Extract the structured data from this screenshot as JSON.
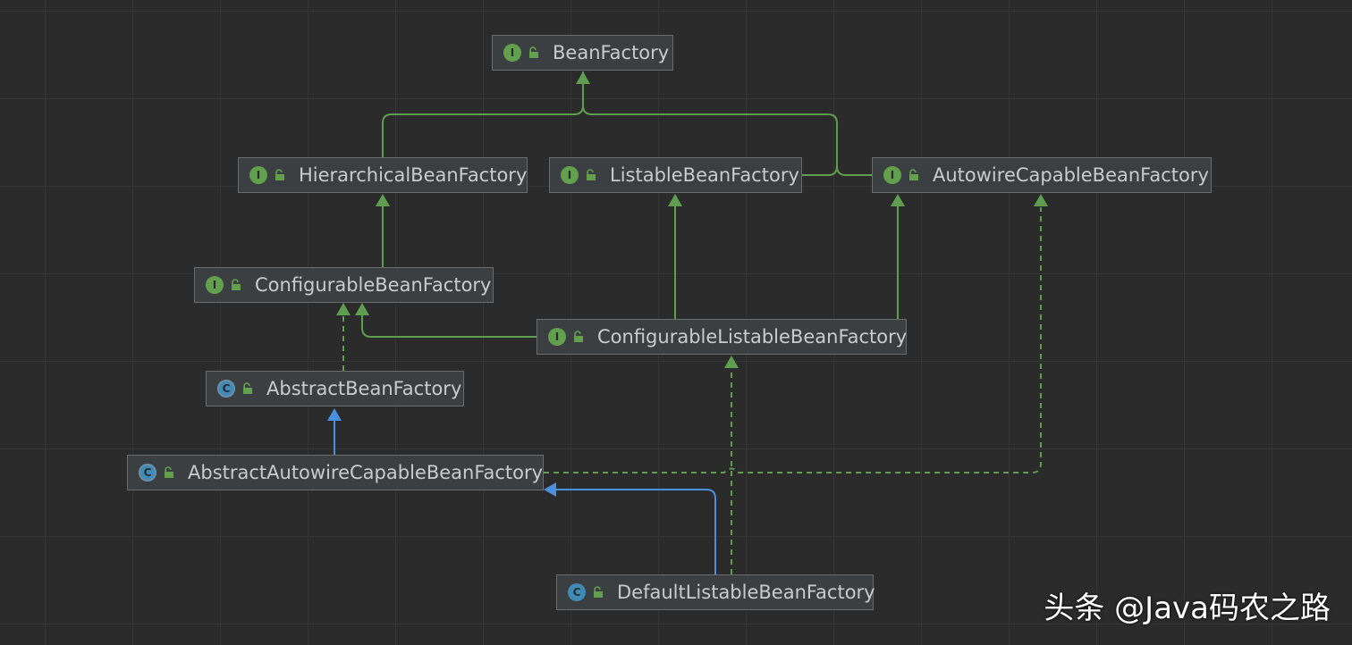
{
  "nodes": [
    {
      "id": "BeanFactory",
      "label": "BeanFactory",
      "kind": "interface",
      "badge": "I"
    },
    {
      "id": "HierarchicalBeanFactory",
      "label": "HierarchicalBeanFactory",
      "kind": "interface",
      "badge": "I"
    },
    {
      "id": "ListableBeanFactory",
      "label": "ListableBeanFactory",
      "kind": "interface",
      "badge": "I"
    },
    {
      "id": "AutowireCapableBeanFactory",
      "label": "AutowireCapableBeanFactory",
      "kind": "interface",
      "badge": "I"
    },
    {
      "id": "ConfigurableBeanFactory",
      "label": "ConfigurableBeanFactory",
      "kind": "interface",
      "badge": "I"
    },
    {
      "id": "ConfigurableListableBeanFactory",
      "label": "ConfigurableListableBeanFactory",
      "kind": "interface",
      "badge": "I"
    },
    {
      "id": "AbstractBeanFactory",
      "label": "AbstractBeanFactory",
      "kind": "abstract",
      "badge": "C"
    },
    {
      "id": "AbstractAutowireCapableBeanFactory",
      "label": "AbstractAutowireCapableBeanFactory",
      "kind": "abstract",
      "badge": "C"
    },
    {
      "id": "DefaultListableBeanFactory",
      "label": "DefaultListableBeanFactory",
      "kind": "class",
      "badge": "C"
    }
  ],
  "edges": [
    {
      "from": "HierarchicalBeanFactory",
      "to": "BeanFactory",
      "type": "extends-interface"
    },
    {
      "from": "ListableBeanFactory",
      "to": "BeanFactory",
      "type": "extends-interface"
    },
    {
      "from": "AutowireCapableBeanFactory",
      "to": "BeanFactory",
      "type": "extends-interface"
    },
    {
      "from": "ConfigurableBeanFactory",
      "to": "HierarchicalBeanFactory",
      "type": "extends-interface"
    },
    {
      "from": "ConfigurableListableBeanFactory",
      "to": "ListableBeanFactory",
      "type": "extends-interface"
    },
    {
      "from": "ConfigurableListableBeanFactory",
      "to": "AutowireCapableBeanFactory",
      "type": "extends-interface"
    },
    {
      "from": "ConfigurableListableBeanFactory",
      "to": "ConfigurableBeanFactory",
      "type": "extends-interface"
    },
    {
      "from": "AbstractBeanFactory",
      "to": "ConfigurableBeanFactory",
      "type": "implements"
    },
    {
      "from": "AbstractAutowireCapableBeanFactory",
      "to": "AbstractBeanFactory",
      "type": "extends-class"
    },
    {
      "from": "AbstractAutowireCapableBeanFactory",
      "to": "AutowireCapableBeanFactory",
      "type": "implements"
    },
    {
      "from": "DefaultListableBeanFactory",
      "to": "AbstractAutowireCapableBeanFactory",
      "type": "extends-class"
    },
    {
      "from": "DefaultListableBeanFactory",
      "to": "ConfigurableListableBeanFactory",
      "type": "implements"
    }
  ],
  "colors": {
    "background": "#2b2b2b",
    "node_fill": "#3c3f41",
    "node_border": "#6a6d70",
    "text": "#c9ccce",
    "interface_badge": "#62a04d",
    "class_badge": "#3e8bb8",
    "edge_interface": "#5f9e4f",
    "edge_class": "#4a8fe0"
  },
  "watermark": "头条 @Java码农之路"
}
